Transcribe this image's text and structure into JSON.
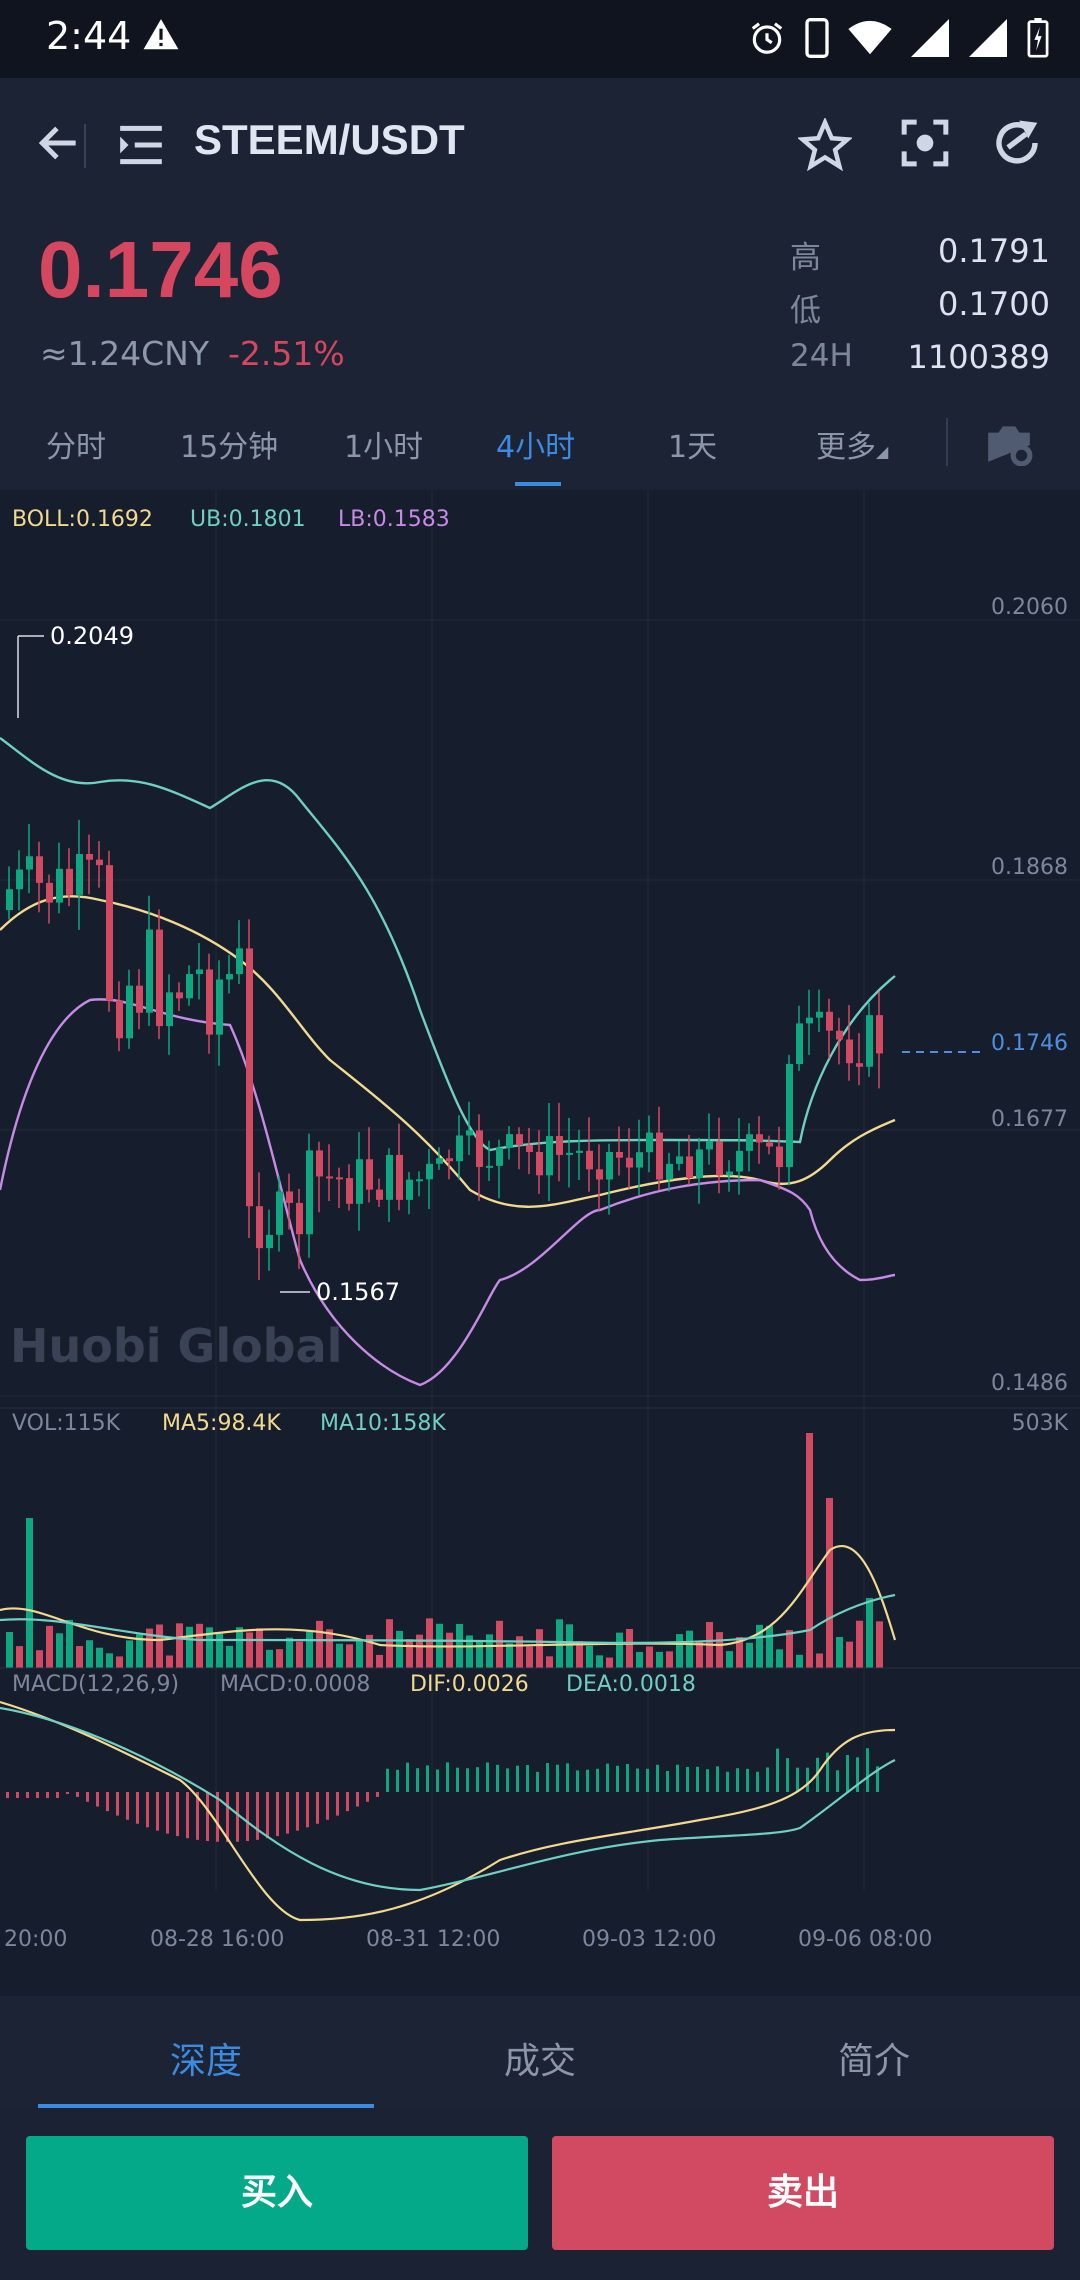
{
  "status_bar": {
    "time": "2:44"
  },
  "header": {
    "pair": "STEEM/USDT"
  },
  "ticker": {
    "price": "0.1746",
    "cny": "≈1.24CNY",
    "change": "-2.51%",
    "stats": [
      {
        "label": "高",
        "value": "0.1791"
      },
      {
        "label": "低",
        "value": "0.1700"
      },
      {
        "label": "24H",
        "value": "1100389"
      }
    ]
  },
  "intervals": [
    "分时",
    "15分钟",
    "1小时",
    "4小时",
    "1天",
    "更多"
  ],
  "active_interval": "4小时",
  "indicators": {
    "boll": "BOLL:0.1692",
    "ub": "UB:0.1801",
    "lb": "LB:0.1583",
    "vol": "VOL:115K",
    "ma5": "MA5:98.4K",
    "ma10": "MA10:158K",
    "vol_max": "503K",
    "macd_params": "MACD(12,26,9)",
    "macd": "MACD:0.0008",
    "dif": "DIF:0.0026",
    "dea": "DEA:0.0018"
  },
  "watermark": "Huobi Global",
  "colors": {
    "up": "#0ea77f",
    "down": "#d24a62",
    "accent": "#3b8be0",
    "boll_mid": "#f2d98f",
    "boll_ub": "#6fd0c0",
    "boll_lb": "#c78ae6"
  },
  "chart_data": {
    "type": "candlestick",
    "price_axis_labels": [
      "0.2060",
      "0.1868",
      "0.1746",
      "0.1677",
      "0.1486"
    ],
    "annotations": {
      "high": "0.2049",
      "low": "0.1567",
      "last": "0.1746"
    },
    "time_axis_labels": [
      "20:00",
      "08-28 16:00",
      "08-31 12:00",
      "09-03 12:00",
      "09-06 08:00"
    ],
    "ylim": [
      0.1486,
      0.206
    ],
    "grid": true
  },
  "bottom_tabs": [
    "深度",
    "成交",
    "简介"
  ],
  "actions": {
    "buy": "买入",
    "sell": "卖出"
  }
}
